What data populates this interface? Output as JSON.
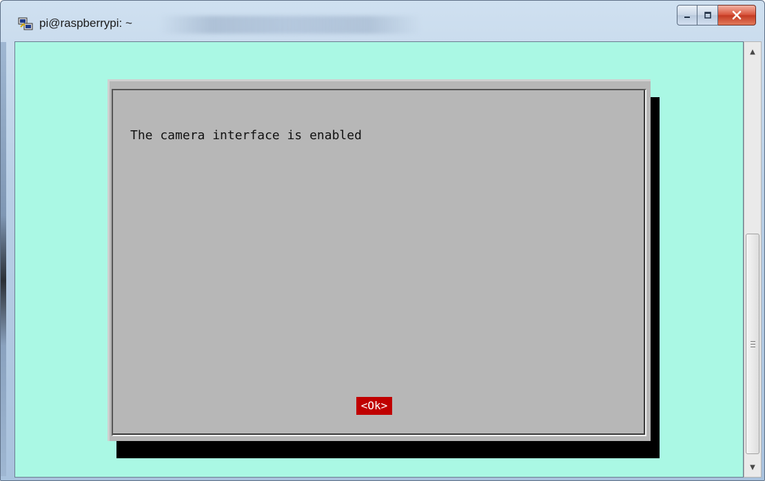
{
  "window": {
    "title": "pi@raspberrypi: ~",
    "icon": "putty-icon",
    "controls": [
      "minimize-icon",
      "maximize-icon",
      "close-icon"
    ],
    "close_glyph": "X"
  },
  "terminal": {
    "background": "#aaf8e4"
  },
  "dialog": {
    "message": "The camera interface is enabled",
    "ok_label": "<Ok>",
    "ok_color": "#c00000"
  },
  "scrollbar": {
    "up_glyph": "▲",
    "down_glyph": "▼"
  }
}
